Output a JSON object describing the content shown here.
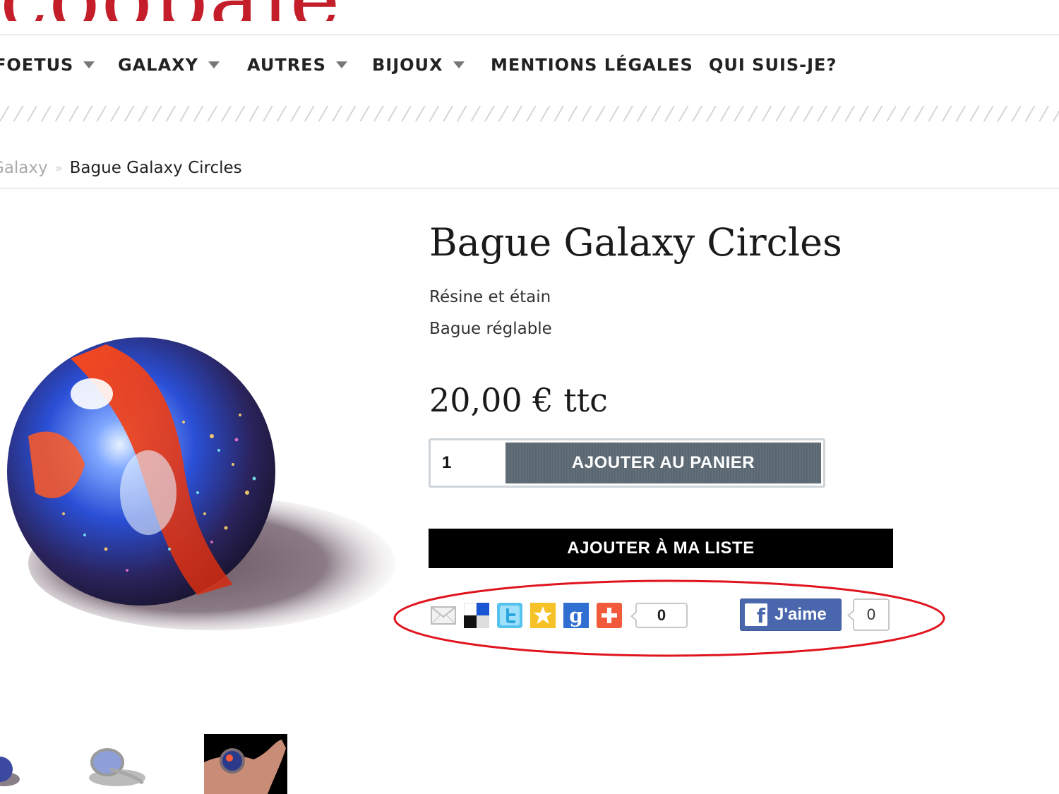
{
  "logo": {
    "text": "coobaie"
  },
  "nav": {
    "items": [
      {
        "label": "FOETUS"
      },
      {
        "label": "GALAXY"
      },
      {
        "label": "AUTRES"
      },
      {
        "label": "BIJOUX"
      },
      {
        "label": "MENTIONS LÉGALES"
      },
      {
        "label": "QUI SUIS-JE?"
      }
    ]
  },
  "breadcrumb": {
    "previous": "Galaxy",
    "separator": "»",
    "current": "Bague Galaxy Circles"
  },
  "product": {
    "title": "Bague Galaxy Circles",
    "description": [
      "Résine et étain",
      "Bague réglable"
    ],
    "price": "20,00 € ttc",
    "quantity": "1",
    "add_to_cart_label": "AJOUTER AU PANIER",
    "add_to_wishlist_label": "AJOUTER À MA LISTE"
  },
  "share": {
    "icons": [
      "email-icon",
      "delicious-icon",
      "twitter-icon",
      "favorite-star-icon",
      "google-plus-icon",
      "addthis-plus-icon"
    ],
    "count": "0"
  },
  "facebook": {
    "like_label": "J'aime",
    "count": "0"
  },
  "colors": {
    "logo_red": "#c41e2a",
    "cart_button": "#5d6a75",
    "wishlist_button": "#000000",
    "facebook_blue": "#4a67ad",
    "highlight_red": "#e0141e"
  }
}
